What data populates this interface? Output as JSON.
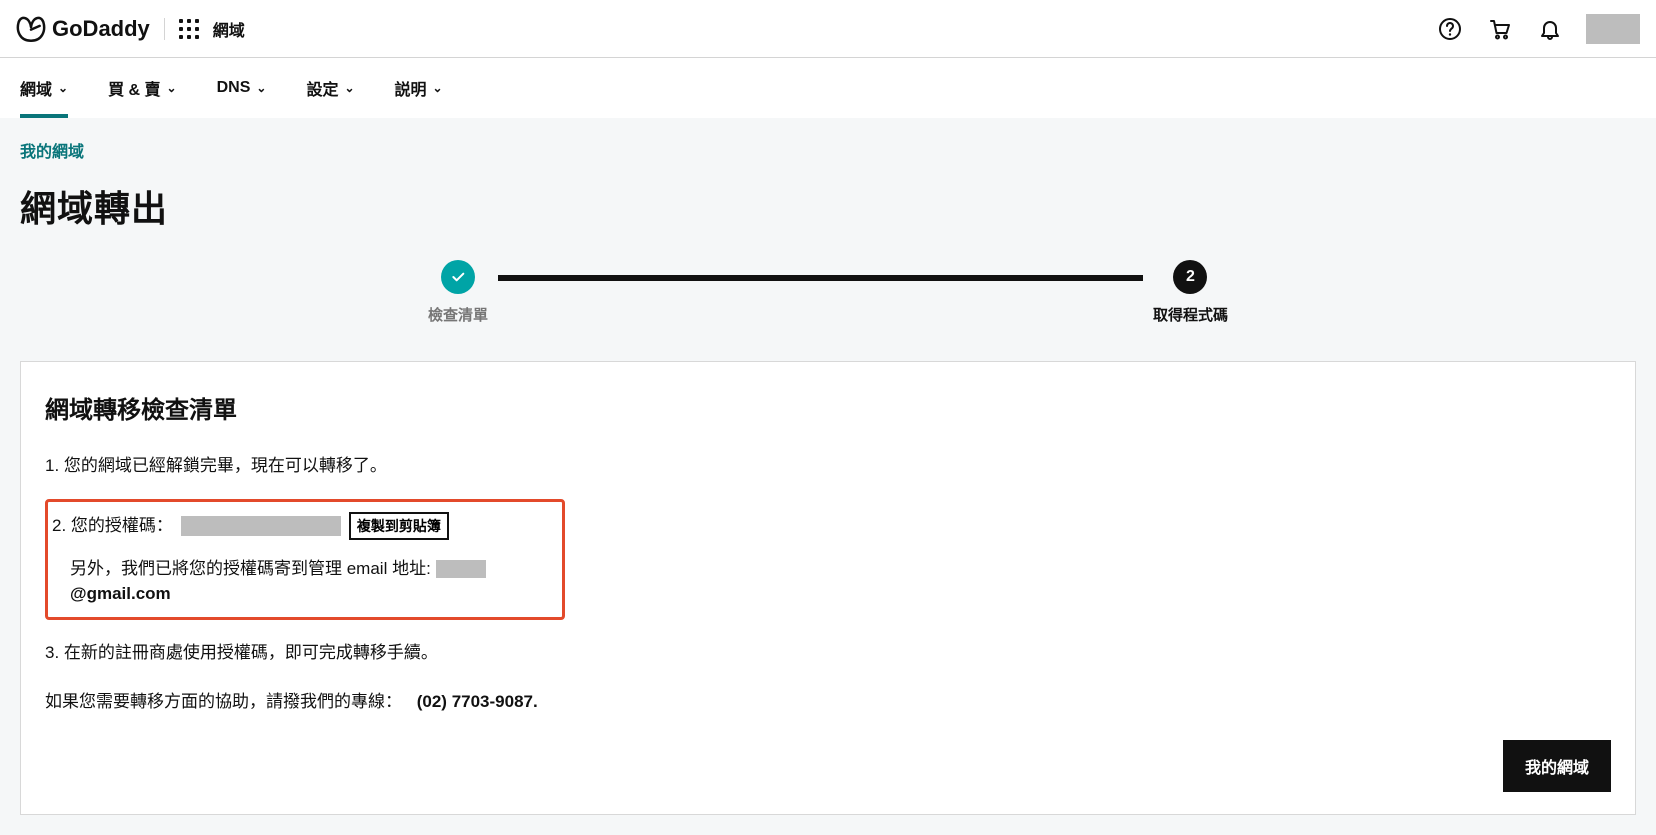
{
  "header": {
    "brand": "GoDaddy",
    "context_label": "網域"
  },
  "subnav": {
    "items": [
      {
        "label": "網域"
      },
      {
        "label": "買 & 賣"
      },
      {
        "label": "DNS"
      },
      {
        "label": "設定"
      },
      {
        "label": "説明"
      }
    ],
    "active_index": 0
  },
  "breadcrumb": {
    "label": "我的網域"
  },
  "page_title": "網域轉出",
  "stepper": {
    "step1_label": "檢查清單",
    "step2_number": "2",
    "step2_label": "取得程式碼"
  },
  "card": {
    "title": "網域轉移檢查清單",
    "item1": "您的網域已經解鎖完畢，現在可以轉移了。",
    "item2_prefix": "您的授權碼：",
    "copy_button": "複製到剪貼簿",
    "item2_sub_prefix": "另外，我們已將您的授權碼寄到管理 email 地址:",
    "item2_email_domain": "@gmail.com",
    "item3": "在新的註冊商處使用授權碼，即可完成轉移手續。",
    "help_text": "如果您需要轉移方面的協助，請撥我們的專線：",
    "help_phone": "(02) 7703-9087.",
    "footer_button": "我的網域"
  }
}
